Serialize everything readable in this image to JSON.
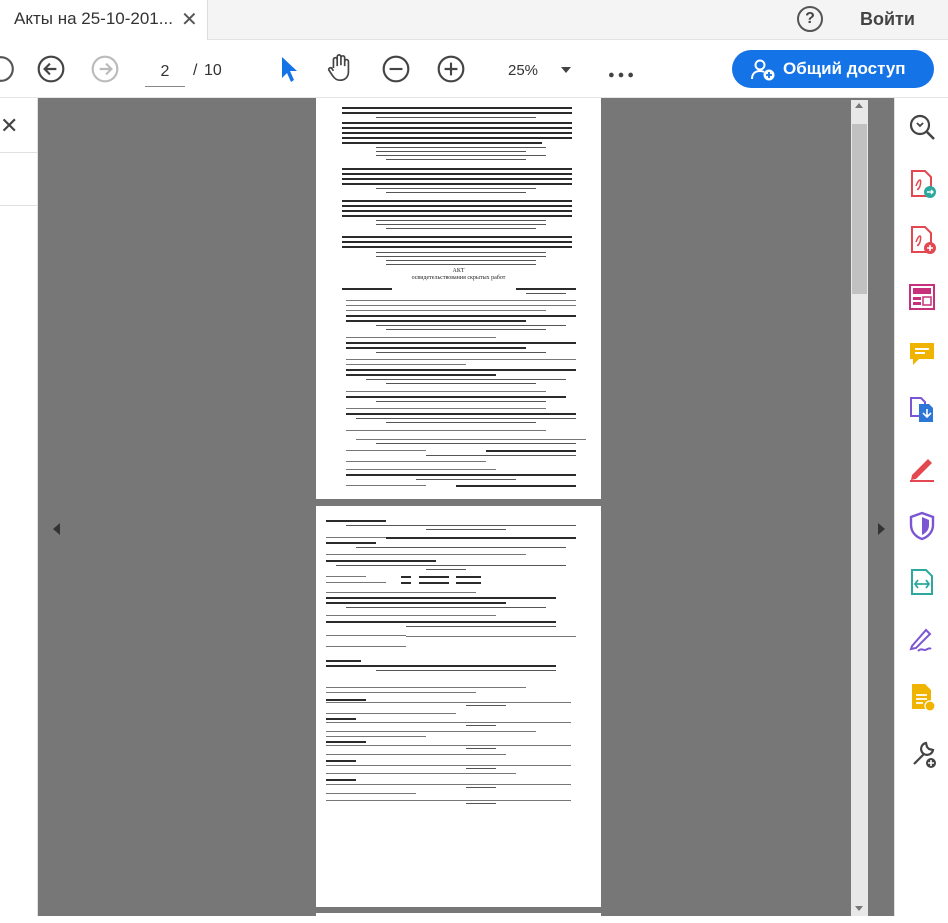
{
  "tab": {
    "title": "Акты на 25-10-201..."
  },
  "header": {
    "help_label": "?",
    "signin_label": "Войти"
  },
  "toolbar": {
    "page_current": "2",
    "page_separator": "/",
    "page_total": "10",
    "zoom": "25%",
    "share_label": "Общий доступ"
  },
  "document": {
    "page1_akt_title": "АКТ",
    "page1_akt_subtitle": "освидетельствования скрытых работ"
  },
  "icons": {
    "back": "arrow-left-circle-icon",
    "forward": "arrow-right-circle-icon",
    "select": "cursor-icon",
    "hand": "hand-icon",
    "zoom_out": "zoom-out-icon",
    "zoom_in": "zoom-in-icon",
    "more": "more-icon",
    "add_user": "add-user-icon"
  },
  "colors": {
    "accent": "#1473e6",
    "doc_bg": "#777777",
    "tool_red": "#e34850",
    "tool_green": "#2da89e",
    "tool_yellow": "#f0b400",
    "tool_purple": "#7b55d3",
    "tool_blue": "#2c76d8"
  }
}
